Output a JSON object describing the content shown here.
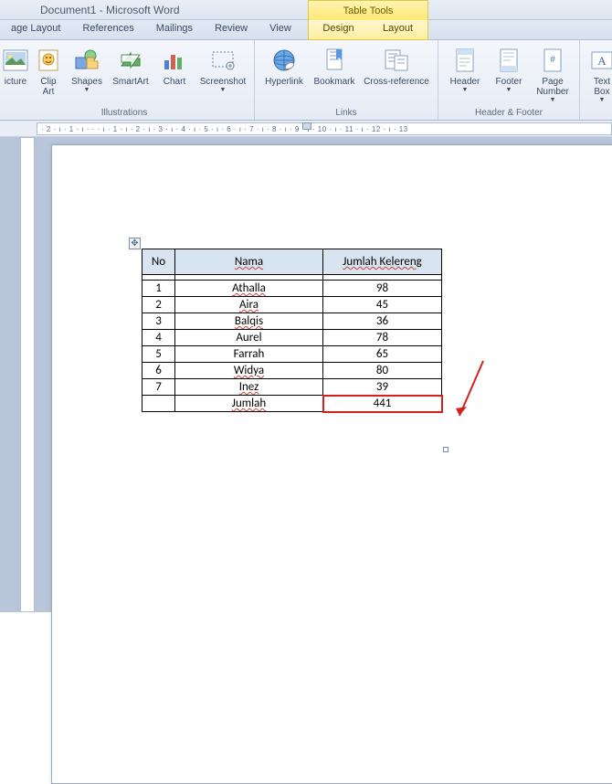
{
  "window": {
    "title": "Document1 - Microsoft Word"
  },
  "tabs": {
    "page_layout": "age Layout",
    "references": "References",
    "mailings": "Mailings",
    "review": "Review",
    "view": "View"
  },
  "contextual": {
    "title": "Table Tools",
    "design": "Design",
    "layout": "Layout"
  },
  "ribbon": {
    "picture": "icture",
    "clipart": "Clip\nArt",
    "shapes": "Shapes",
    "smartart": "SmartArt",
    "chart": "Chart",
    "screenshot": "Screenshot",
    "hyperlink": "Hyperlink",
    "bookmark": "Bookmark",
    "crossref": "Cross-reference",
    "header": "Header",
    "footer": "Footer",
    "pagenum": "Page\nNumber",
    "textbox": "Text\nBox",
    "group_illustrations": "Illustrations",
    "group_links": "Links",
    "group_headerfooter": "Header & Footer"
  },
  "ruler": "· 2 · ı · 1 · ı · · · ı · 1 · ı · 2 · ı · 3 · ı · 4 · ı · 5 · ı · 6 · ı · 7 · ı · 8 · ı · 9 · ı · 10 · ı · 11 · ı · 12 · ı · 13",
  "table": {
    "headers": {
      "no": "No",
      "nama": "Nama",
      "jumlah": "Jumlah Kelereng"
    },
    "rows": [
      {
        "no": "1",
        "nama": "Athalla",
        "val": "98"
      },
      {
        "no": "2",
        "nama": "Aira",
        "val": "45"
      },
      {
        "no": "3",
        "nama": "Balqis",
        "val": "36"
      },
      {
        "no": "4",
        "nama": "Aurel",
        "val": "78"
      },
      {
        "no": "5",
        "nama": "Farrah",
        "val": "65"
      },
      {
        "no": "6",
        "nama": "Widya",
        "val": "80"
      },
      {
        "no": "7",
        "nama": "Inez",
        "val": "39"
      }
    ],
    "total_label": "Jumlah",
    "total_value": "441"
  }
}
